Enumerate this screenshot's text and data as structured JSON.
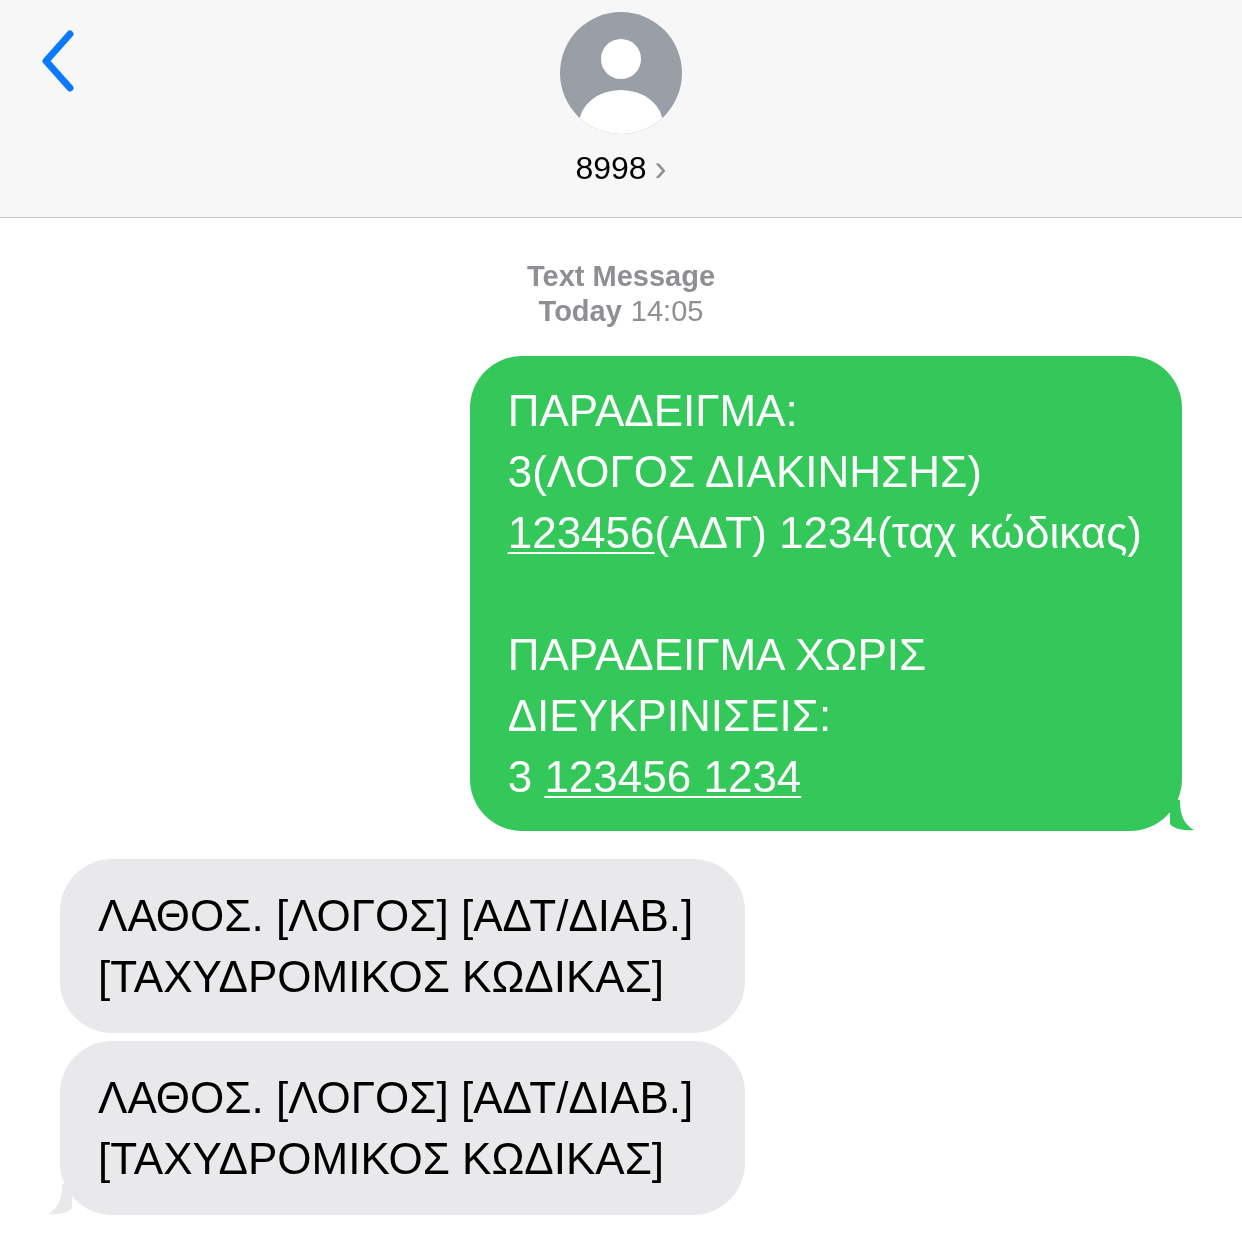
{
  "header": {
    "contact": "8998",
    "chevron": "›"
  },
  "timestamp": {
    "service": "Text Message",
    "day": "Today",
    "time": "14:05"
  },
  "messages": [
    {
      "kind": "sent",
      "tail": true,
      "paragraphs": [
        [
          [
            {
              "kind": "text",
              "text": "ΠΑΡΑΔΕΙΓΜΑ:"
            }
          ],
          [
            {
              "kind": "text",
              "text": "3(ΛΟΓΟΣ ΔΙΑΚΙΝΗΣΗΣ)"
            }
          ],
          [
            {
              "kind": "link",
              "text": "123456"
            },
            {
              "kind": "text",
              "text": "(ΑΔΤ) 1234(ταχ κώδικας)"
            }
          ]
        ],
        [
          [
            {
              "kind": "text",
              "text": "ΠΑΡΑΔΕΙΓΜΑ ΧΩΡΙΣ"
            }
          ],
          [
            {
              "kind": "text",
              "text": "ΔΙΕΥΚΡΙΝΙΣΕΙΣ:"
            }
          ],
          [
            {
              "kind": "text",
              "text": "3 "
            },
            {
              "kind": "link",
              "text": "123456 1234"
            }
          ]
        ]
      ]
    },
    {
      "kind": "received",
      "tail": false,
      "paragraphs": [
        [
          [
            {
              "kind": "text",
              "text": "ΛΑΘΟΣ. [ΛΟΓΟΣ] [ΑΔΤ/ΔΙΑΒ.]"
            }
          ],
          [
            {
              "kind": "text",
              "text": "[ΤΑΧΥΔΡΟΜΙΚΟΣ ΚΩΔΙΚΑΣ]"
            }
          ]
        ]
      ]
    },
    {
      "kind": "received",
      "tail": true,
      "paragraphs": [
        [
          [
            {
              "kind": "text",
              "text": "ΛΑΘΟΣ. [ΛΟΓΟΣ] [ΑΔΤ/ΔΙΑΒ.]"
            }
          ],
          [
            {
              "kind": "text",
              "text": "[ΤΑΧΥΔΡΟΜΙΚΟΣ ΚΩΔΙΚΑΣ]"
            }
          ]
        ]
      ]
    }
  ]
}
